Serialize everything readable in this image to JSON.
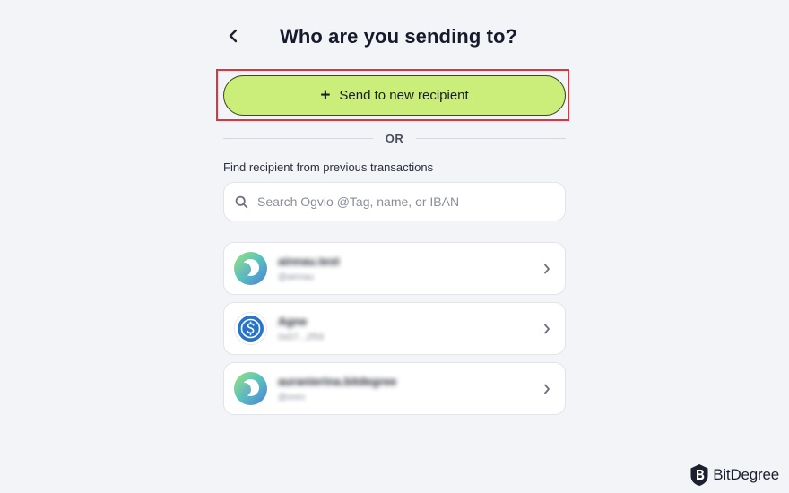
{
  "header": {
    "title": "Who are you sending to?",
    "back_icon": "chevron-left-icon"
  },
  "send_new": {
    "label": "Send to new recipient",
    "plus": "+",
    "color": "#cbee7a",
    "highlight_color": "#d9363e"
  },
  "divider": {
    "label": "OR"
  },
  "find": {
    "label": "Find recipient from previous transactions"
  },
  "search": {
    "placeholder": "Search Ogvio @Tag, name, or IBAN",
    "value": ""
  },
  "recipients": [
    {
      "name": "ainnau.test",
      "handle": "@ainnau",
      "avatar": "ogvio-logo-icon"
    },
    {
      "name": "Agne",
      "handle": "0xD7...2f59",
      "avatar": "usdc-coin-icon"
    },
    {
      "name": "auranierina.bitdegree",
      "handle": "@oreo",
      "avatar": "ogvio-logo-icon"
    }
  ],
  "brand": {
    "name": "BitDegree"
  }
}
